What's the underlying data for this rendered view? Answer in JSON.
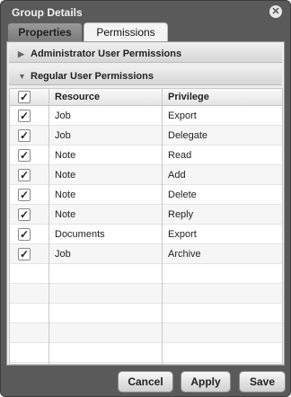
{
  "window": {
    "title": "Group Details"
  },
  "tabs": [
    {
      "label": "Properties",
      "active": false
    },
    {
      "label": "Permissions",
      "active": true
    }
  ],
  "sections": {
    "admin": {
      "label": "Administrator User Permissions",
      "expanded": false
    },
    "regular": {
      "label": "Regular User Permissions",
      "expanded": true
    }
  },
  "table": {
    "columns": {
      "resource": "Resource",
      "privilege": "Privilege"
    },
    "header_checked": true,
    "rows": [
      {
        "checked": true,
        "resource": "Job",
        "privilege": "Export"
      },
      {
        "checked": true,
        "resource": "Job",
        "privilege": "Delegate"
      },
      {
        "checked": true,
        "resource": "Note",
        "privilege": "Read"
      },
      {
        "checked": true,
        "resource": "Note",
        "privilege": "Add"
      },
      {
        "checked": true,
        "resource": "Note",
        "privilege": "Delete"
      },
      {
        "checked": true,
        "resource": "Note",
        "privilege": "Reply"
      },
      {
        "checked": true,
        "resource": "Documents",
        "privilege": "Export"
      },
      {
        "checked": true,
        "resource": "Job",
        "privilege": "Archive"
      }
    ]
  },
  "buttons": {
    "cancel": "Cancel",
    "apply": "Apply",
    "save": "Save"
  },
  "icons": {
    "close": "close-icon",
    "collapsed": "triangle-right-icon",
    "expanded": "triangle-down-icon",
    "check": "check-icon"
  }
}
